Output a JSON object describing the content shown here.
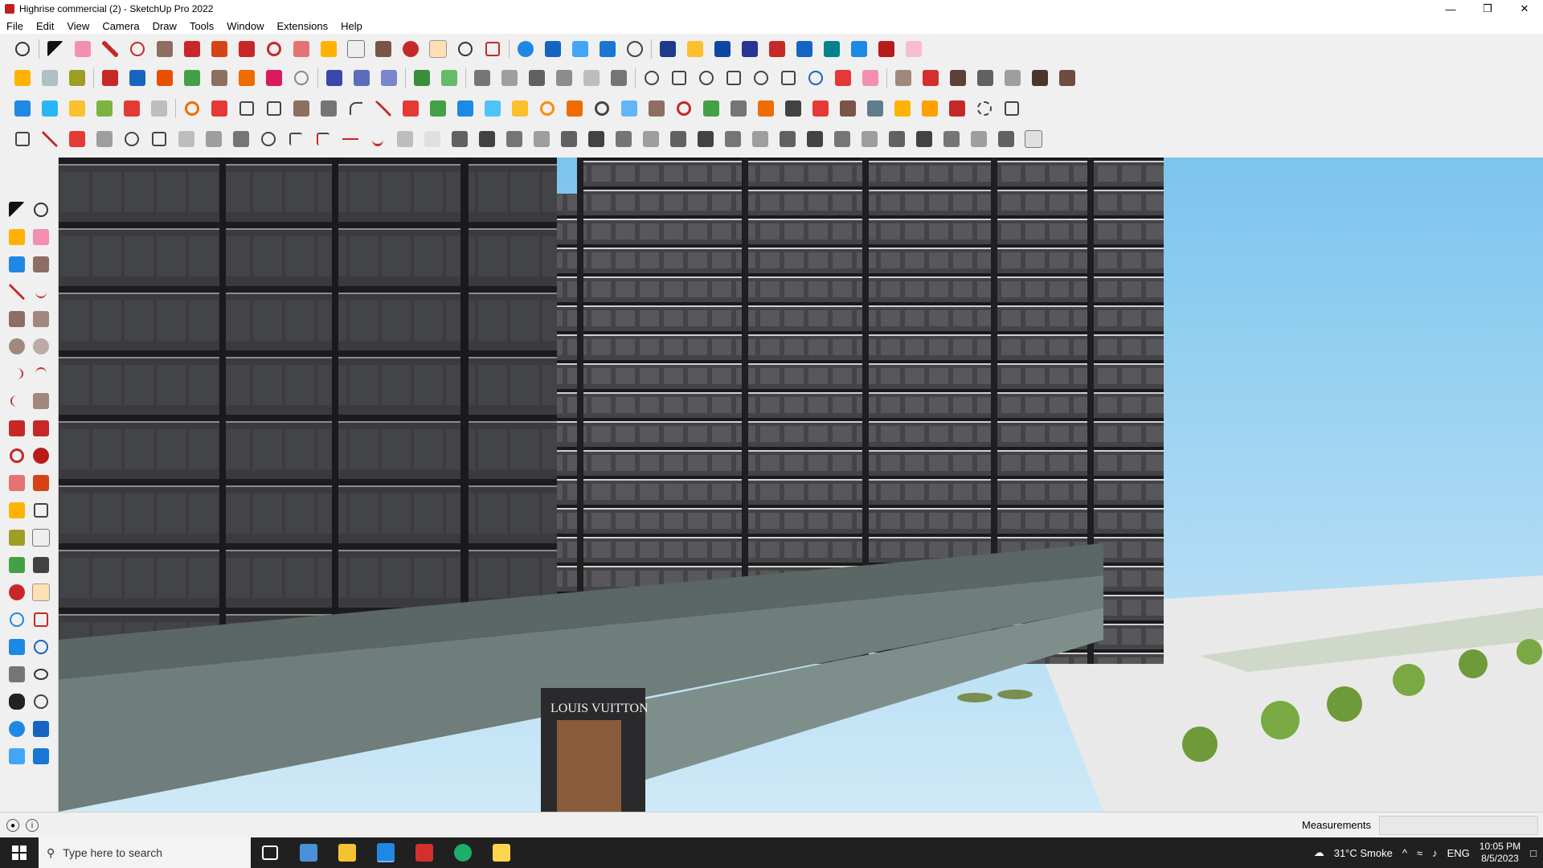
{
  "window": {
    "title": "Highrise commercial (2) - SketchUp Pro 2022"
  },
  "menubar": {
    "items": [
      "File",
      "Edit",
      "View",
      "Camera",
      "Draw",
      "Tools",
      "Window",
      "Extensions",
      "Help"
    ]
  },
  "viewport": {
    "storefront_sign_1": "LOUIS VUITTON"
  },
  "statusbar": {
    "measurements_label": "Measurements",
    "measurements_value": ""
  },
  "taskbar": {
    "search_placeholder": "Type here to search",
    "weather": "31°C  Smoke",
    "language": "ENG",
    "time": "10:05 PM",
    "date": "8/5/2023"
  },
  "colors": {
    "accent": "#1e88e5",
    "sketchup_red": "#c62828",
    "building_dark": "#3a3a3c",
    "sky": "#9cd3f0",
    "ground": "#e9e9e9",
    "taskbar": "#202020"
  }
}
